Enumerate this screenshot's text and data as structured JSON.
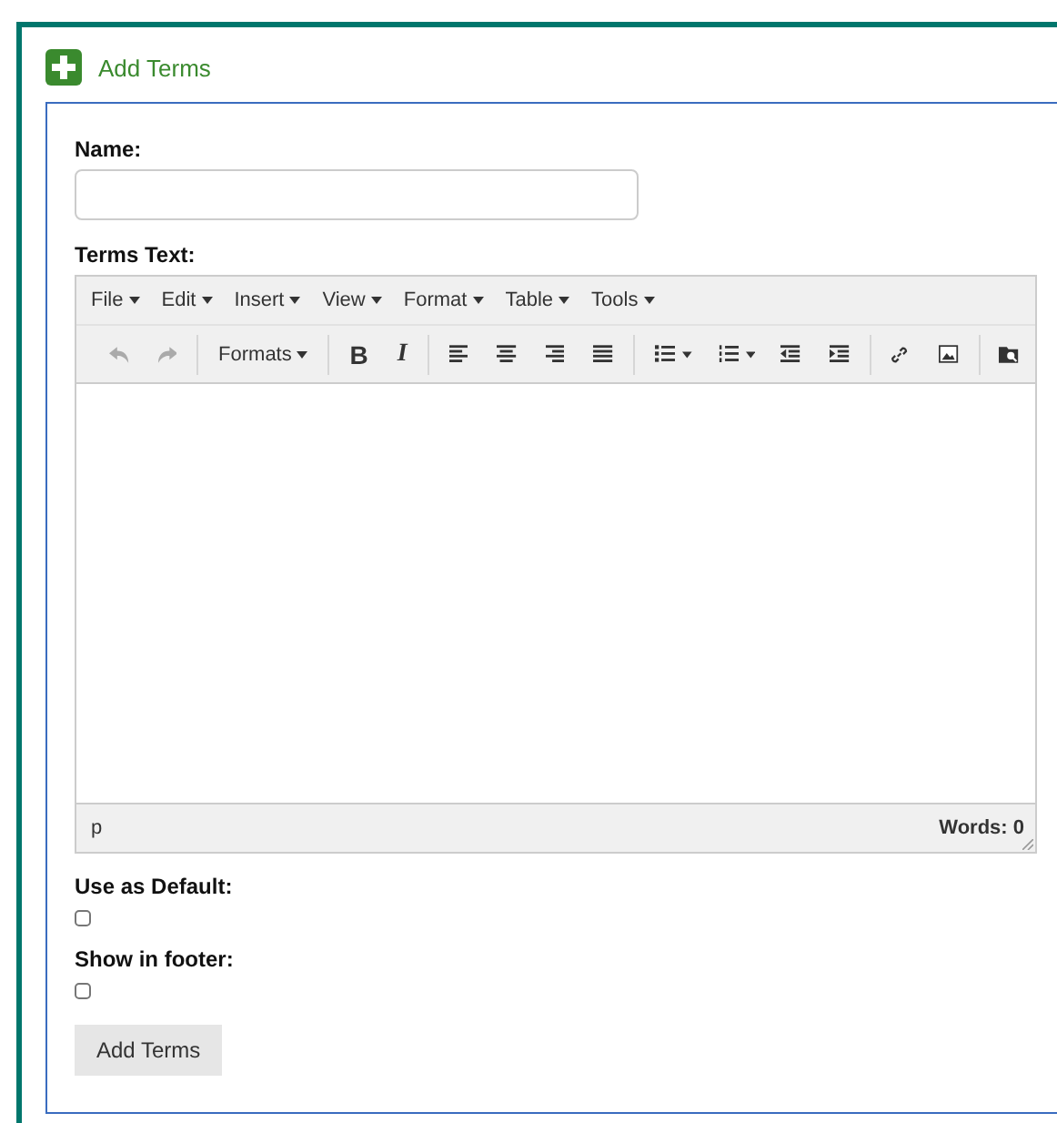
{
  "header": {
    "title": "Add Terms"
  },
  "form": {
    "name_label": "Name:",
    "terms_label": "Terms Text:",
    "editor": {
      "menus": [
        "File",
        "Edit",
        "Insert",
        "View",
        "Format",
        "Table",
        "Tools"
      ],
      "toolbar": [
        {
          "kind": "undo",
          "disabled": true
        },
        {
          "kind": "redo",
          "disabled": true
        },
        {
          "kind": "sep"
        },
        {
          "kind": "dropdown",
          "label": "Formats"
        },
        {
          "kind": "sep"
        },
        {
          "kind": "bold",
          "label": "B"
        },
        {
          "kind": "italic",
          "label": "I"
        },
        {
          "kind": "sep"
        },
        {
          "kind": "align-left"
        },
        {
          "kind": "align-center"
        },
        {
          "kind": "align-right"
        },
        {
          "kind": "justify"
        },
        {
          "kind": "sep"
        },
        {
          "kind": "bullets"
        },
        {
          "kind": "caret"
        },
        {
          "kind": "numbers"
        },
        {
          "kind": "caret"
        },
        {
          "kind": "outdent"
        },
        {
          "kind": "indent"
        },
        {
          "kind": "sep"
        },
        {
          "kind": "link"
        },
        {
          "kind": "image"
        },
        {
          "kind": "sep"
        },
        {
          "kind": "preview"
        }
      ],
      "path": "p",
      "word_count": "Words: 0"
    },
    "options": [
      {
        "label": "Use as Default:",
        "checked": false
      },
      {
        "label": "Show in footer:",
        "checked": false
      }
    ],
    "submit": "Add Terms"
  }
}
